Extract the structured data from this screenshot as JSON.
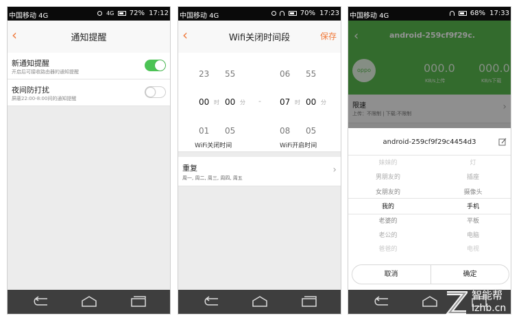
{
  "status_bars": [
    {
      "carrier": "中国移动 4G",
      "signal": "4G",
      "battery": "72%",
      "time": "17:12"
    },
    {
      "carrier": "中国移动 4G",
      "battery": "70%",
      "time": "17:23"
    },
    {
      "carrier": "中国移动 4G",
      "battery": "68%",
      "time": "17:33"
    }
  ],
  "screen1": {
    "title": "通知提醒",
    "items": [
      {
        "label": "新通知提醒",
        "sub": "开启后可接收路由器的通知提醒",
        "enabled": true
      },
      {
        "label": "夜间防打扰",
        "sub": "屏蔽22:00-8:00间的通知提醒",
        "enabled": false
      }
    ]
  },
  "screen2": {
    "title": "Wifi关闭时间段",
    "save": "保存",
    "off": {
      "prev_h": "23",
      "prev_m": "55",
      "h": "00",
      "m": "00",
      "next_h": "01",
      "next_m": "05",
      "label": "WiFi关闭时间"
    },
    "on": {
      "prev_h": "06",
      "prev_m": "55",
      "h": "07",
      "m": "00",
      "next_h": "08",
      "next_m": "05",
      "label": "WiFi开启时间"
    },
    "unit_h": "时",
    "unit_m": "分",
    "sep": "-",
    "repeat_label": "重复",
    "repeat_days": "周一, 周二, 周三, 周四, 周五"
  },
  "screen3": {
    "device_title": "android-259cf9f29c.",
    "logo": "oppo",
    "upload": "000.0",
    "upload_unit": "KB/s上传",
    "download": "000.0",
    "download_unit": "KB/s下载",
    "limit_label": "限速",
    "limit_sub": "上传：不限制 | 下载:不限制",
    "dialog_name": "android-259cf9f29c4454d3",
    "owners": [
      "妹妹的",
      "男朋友的",
      "女朋友的",
      "我的",
      "老婆的",
      "老公的",
      "爸爸的"
    ],
    "types": [
      "灯",
      "插座",
      "摄像头",
      "手机",
      "平板",
      "电脑",
      "电视"
    ],
    "cancel": "取消",
    "confirm": "确定"
  },
  "watermark": {
    "brand": "智能帮",
    "url": "Izhb.cn"
  },
  "colors": {
    "accent": "#f07a3b",
    "toggle_on": "#4cc355",
    "hero_green": "#58b94e",
    "nav": "#3e3e3e"
  }
}
